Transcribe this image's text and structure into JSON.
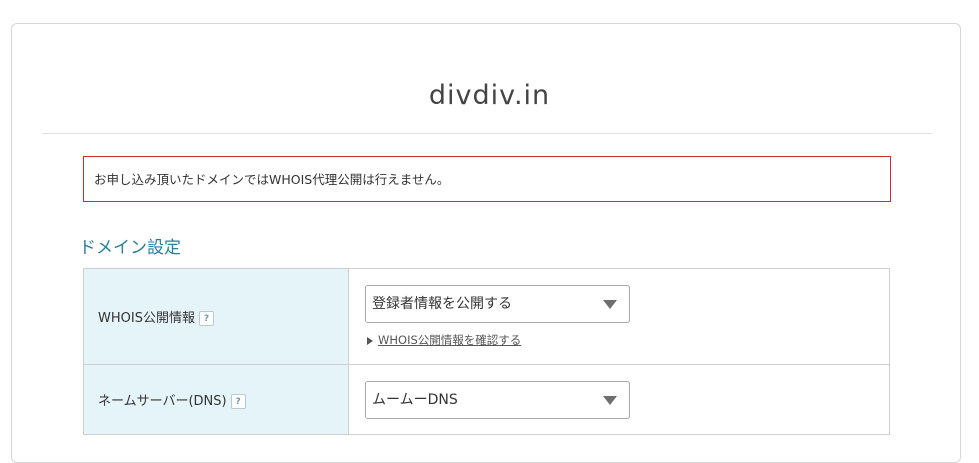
{
  "header": {
    "domain_name": "divdiv.in"
  },
  "alert": {
    "message": "お申し込み頂いたドメインではWHOIS代理公開は行えません。"
  },
  "domain_settings": {
    "heading": "ドメイン設定",
    "rows": [
      {
        "label": "WHOIS公開情報",
        "help_icon": "?",
        "select_value": "登録者情報を公開する",
        "link_label": "WHOIS公開情報を確認する"
      },
      {
        "label": "ネームサーバー(DNS)",
        "help_icon": "?",
        "select_value": "ムームーDNS"
      }
    ]
  },
  "colors": {
    "alert_border": "#cc2e2e",
    "heading": "#2a7f9a",
    "label_cell_bg": "#e4f4f9"
  },
  "icons": [
    "help-icon",
    "dropdown-arrow-icon",
    "triangle-right-icon"
  ]
}
